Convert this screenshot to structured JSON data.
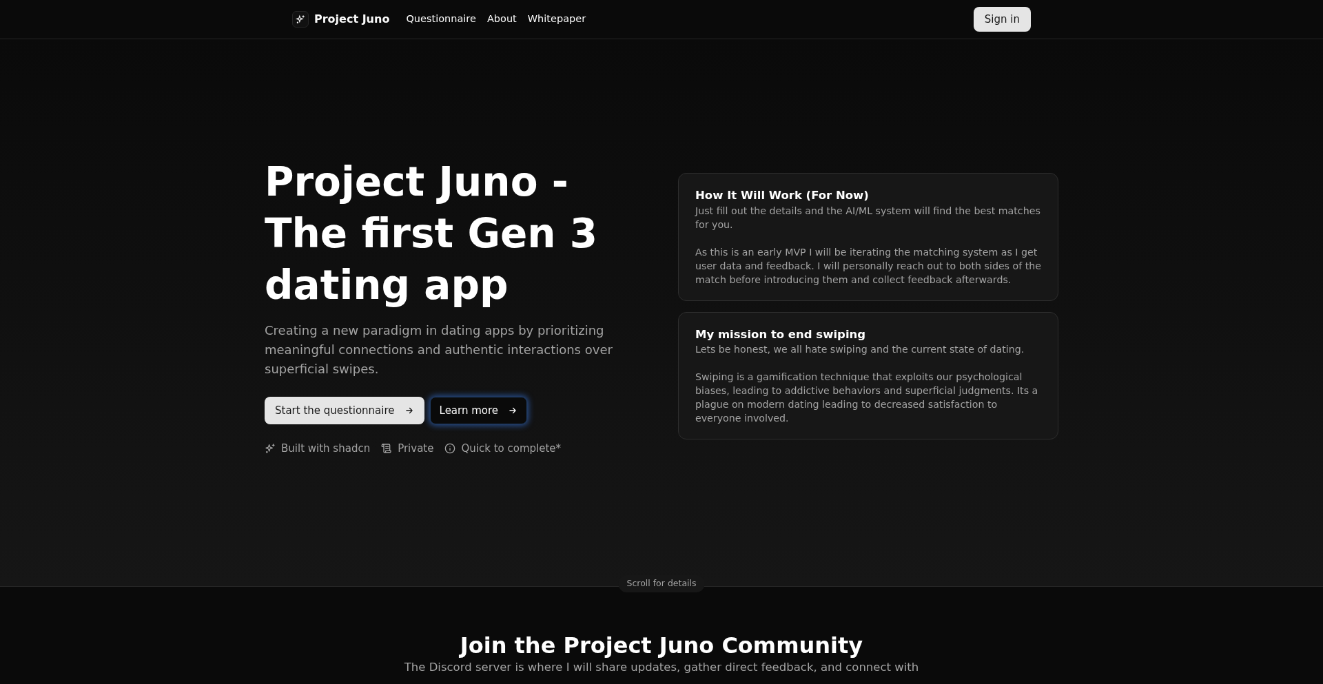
{
  "nav": {
    "brand": "Project Juno",
    "links": [
      "Questionnaire",
      "About",
      "Whitepaper"
    ],
    "sign_in": "Sign in"
  },
  "hero": {
    "title": "Project Juno - The first Gen 3 dating app",
    "subtitle": "Creating a new paradigm in dating apps by prioritizing meaningful connections and authentic interactions over superficial swipes.",
    "buttons": [
      {
        "label": "Start the questionnaire",
        "kind": "primary"
      },
      {
        "label": "Learn more",
        "kind": "glow"
      }
    ],
    "features": [
      "Built with shadcn",
      "Private",
      "Quick to complete*"
    ]
  },
  "cards": [
    {
      "title": "How It Will Work (For Now)",
      "paragraphs": [
        "Just fill out the details and the AI/ML system will find the best matches for you.",
        "As this is an early MVP I will be iterating the matching system as I get user data and feedback. I will personally reach out to both sides of the match before introducing them and collect feedback afterwards."
      ]
    },
    {
      "title": "My mission to end swiping",
      "paragraphs": [
        "Lets be honest, we all hate swiping and the current state of dating.",
        "Swiping is a gamification technique that exploits our psychological biases, leading to addictive behaviors and superficial judgments. Its a plague on modern dating leading to decreased satisfaction to everyone involved."
      ]
    }
  ],
  "scroll_hint": "Scroll for details",
  "community": {
    "title": "Join the Project Juno Community",
    "text": "The Discord server is where I will share updates, gather direct feedback, and connect with"
  }
}
